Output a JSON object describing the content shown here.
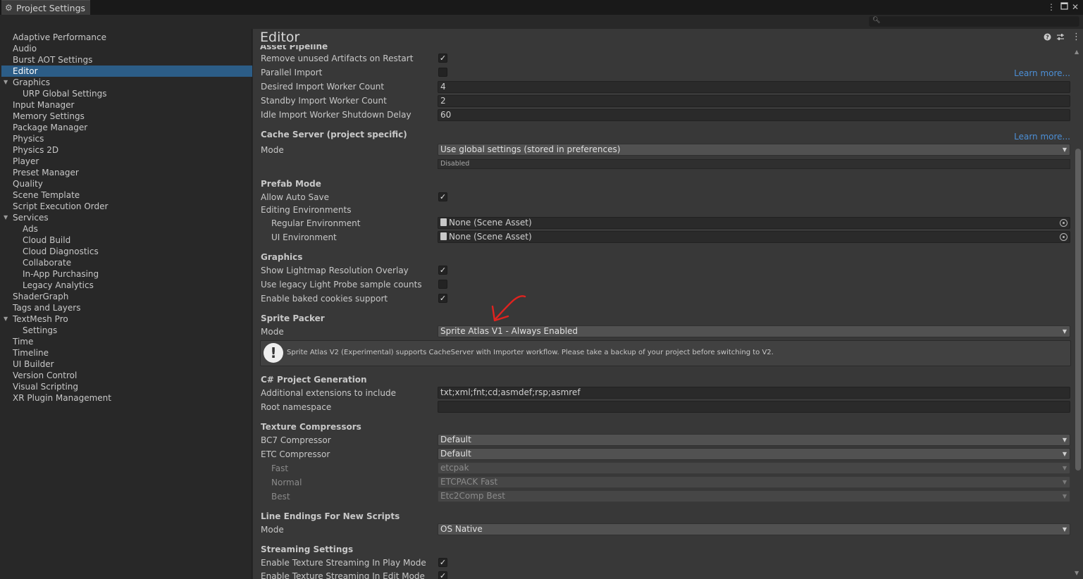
{
  "window": {
    "tab_title": "Project Settings",
    "menu_icon": "kebab-icon",
    "maximize_icon": "maximize-icon",
    "close_icon": "close-icon"
  },
  "search": {
    "placeholder": "",
    "value": ""
  },
  "sidebar": {
    "items": [
      {
        "label": "Adaptive Performance",
        "indent": 0
      },
      {
        "label": "Audio",
        "indent": 0
      },
      {
        "label": "Burst AOT Settings",
        "indent": 0
      },
      {
        "label": "Editor",
        "indent": 0,
        "selected": true
      },
      {
        "label": "Graphics",
        "indent": 0,
        "foldout": true
      },
      {
        "label": "URP Global Settings",
        "indent": 1
      },
      {
        "label": "Input Manager",
        "indent": 0
      },
      {
        "label": "Memory Settings",
        "indent": 0
      },
      {
        "label": "Package Manager",
        "indent": 0
      },
      {
        "label": "Physics",
        "indent": 0
      },
      {
        "label": "Physics 2D",
        "indent": 0
      },
      {
        "label": "Player",
        "indent": 0
      },
      {
        "label": "Preset Manager",
        "indent": 0
      },
      {
        "label": "Quality",
        "indent": 0
      },
      {
        "label": "Scene Template",
        "indent": 0
      },
      {
        "label": "Script Execution Order",
        "indent": 0
      },
      {
        "label": "Services",
        "indent": 0,
        "foldout": true
      },
      {
        "label": "Ads",
        "indent": 1
      },
      {
        "label": "Cloud Build",
        "indent": 1
      },
      {
        "label": "Cloud Diagnostics",
        "indent": 1
      },
      {
        "label": "Collaborate",
        "indent": 1
      },
      {
        "label": "In-App Purchasing",
        "indent": 1
      },
      {
        "label": "Legacy Analytics",
        "indent": 1
      },
      {
        "label": "ShaderGraph",
        "indent": 0
      },
      {
        "label": "Tags and Layers",
        "indent": 0
      },
      {
        "label": "TextMesh Pro",
        "indent": 0,
        "foldout": true
      },
      {
        "label": "Settings",
        "indent": 1
      },
      {
        "label": "Time",
        "indent": 0
      },
      {
        "label": "Timeline",
        "indent": 0
      },
      {
        "label": "UI Builder",
        "indent": 0
      },
      {
        "label": "Version Control",
        "indent": 0
      },
      {
        "label": "Visual Scripting",
        "indent": 0
      },
      {
        "label": "XR Plugin Management",
        "indent": 0
      }
    ]
  },
  "main": {
    "title": "Editor",
    "cut_header": "Asset Pipeline",
    "asset_pipeline": {
      "remove_unused": {
        "label": "Remove unused Artifacts on Restart",
        "checked": true
      },
      "parallel_import": {
        "label": "Parallel Import",
        "checked": false
      },
      "learn_more": "Learn more...",
      "desired_worker": {
        "label": "Desired Import Worker Count",
        "value": "4"
      },
      "standby_worker": {
        "label": "Standby Import Worker Count",
        "value": "2"
      },
      "idle_shutdown": {
        "label": "Idle Import Worker Shutdown Delay",
        "value": "60"
      }
    },
    "cache_server": {
      "header": "Cache Server (project specific)",
      "learn_more": "Learn more...",
      "mode_label": "Mode",
      "mode_value": "Use global settings (stored in preferences)",
      "status": "Disabled"
    },
    "prefab_mode": {
      "header": "Prefab Mode",
      "allow_auto_save": {
        "label": "Allow Auto Save",
        "checked": true
      },
      "editing_envs": "Editing Environments",
      "regular_env": {
        "label": "Regular Environment",
        "value": "None (Scene Asset)"
      },
      "ui_env": {
        "label": "UI Environment",
        "value": "None (Scene Asset)"
      }
    },
    "graphics": {
      "header": "Graphics",
      "lightmap_overlay": {
        "label": "Show Lightmap Resolution Overlay",
        "checked": true
      },
      "legacy_probe": {
        "label": "Use legacy Light Probe sample counts",
        "checked": false
      },
      "baked_cookies": {
        "label": "Enable baked cookies support",
        "checked": true
      }
    },
    "sprite_packer": {
      "header": "Sprite Packer",
      "mode_label": "Mode",
      "mode_value": "Sprite Atlas V1 - Always Enabled",
      "help": "Sprite Atlas V2 (Experimental) supports CacheServer with Importer workflow. Please take a backup of your project before switching to V2."
    },
    "csharp": {
      "header": "C# Project Generation",
      "extensions": {
        "label": "Additional extensions to include",
        "value": "txt;xml;fnt;cd;asmdef;rsp;asmref"
      },
      "root_ns": {
        "label": "Root namespace",
        "value": ""
      }
    },
    "texture_compressors": {
      "header": "Texture Compressors",
      "bc7": {
        "label": "BC7 Compressor",
        "value": "Default"
      },
      "etc": {
        "label": "ETC Compressor",
        "value": "Default"
      },
      "fast": {
        "label": "Fast",
        "value": "etcpak"
      },
      "normal": {
        "label": "Normal",
        "value": "ETCPACK Fast"
      },
      "best": {
        "label": "Best",
        "value": "Etc2Comp Best"
      }
    },
    "line_endings": {
      "header": "Line Endings For New Scripts",
      "mode_label": "Mode",
      "mode_value": "OS Native"
    },
    "streaming": {
      "header": "Streaming Settings",
      "play_mode": {
        "label": "Enable Texture Streaming In Play Mode",
        "checked": true
      },
      "edit_mode": {
        "label": "Enable Texture Streaming In Edit Mode",
        "checked": true
      }
    }
  },
  "colors": {
    "selection": "#2c5d87",
    "link": "#4c8fd6",
    "annotation": "#e0231f"
  }
}
